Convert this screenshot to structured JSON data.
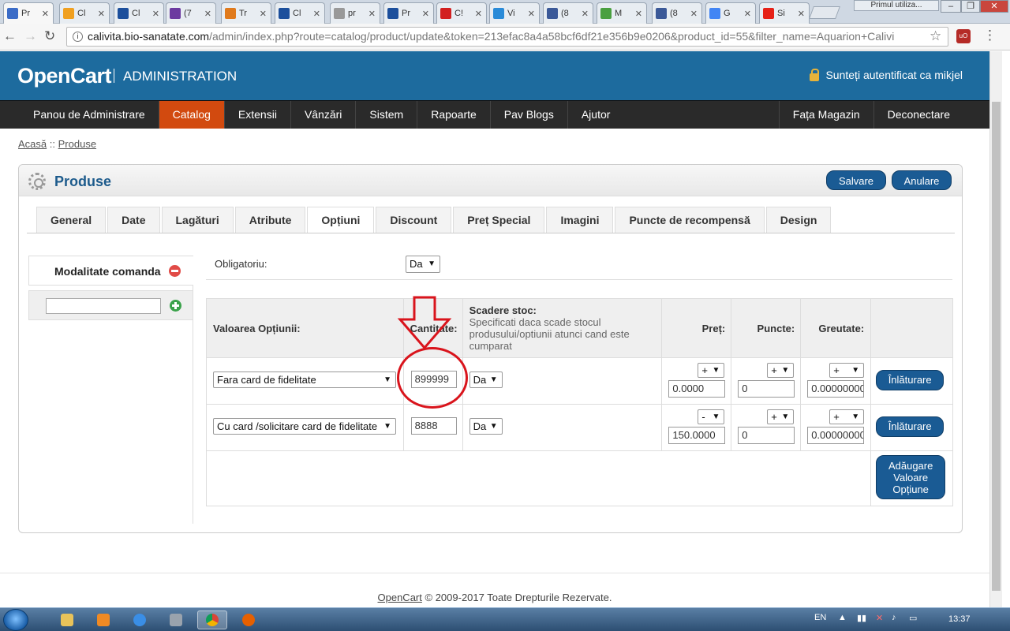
{
  "browser": {
    "tabs": [
      {
        "label": "Pr",
        "color": "#3b6cc7"
      },
      {
        "label": "Cl",
        "color": "#f0a020"
      },
      {
        "label": "Cl",
        "color": "#1c4f9c"
      },
      {
        "label": "(7",
        "color": "#6c3aa0"
      },
      {
        "label": "Tr",
        "color": "#e07a1c"
      },
      {
        "label": "Cl",
        "color": "#1c4f9c"
      },
      {
        "label": "pr",
        "color": "#999999"
      },
      {
        "label": "Pr",
        "color": "#1c4f9c"
      },
      {
        "label": "C!",
        "color": "#d22020"
      },
      {
        "label": "Vi",
        "color": "#2a8bd8"
      },
      {
        "label": "(8",
        "color": "#3b5998"
      },
      {
        "label": "M",
        "color": "#4aa040"
      },
      {
        "label": "(8",
        "color": "#3b5998"
      },
      {
        "label": "G",
        "color": "#4285f4"
      },
      {
        "label": "Si",
        "color": "#e62117"
      }
    ],
    "profile": "Primul utiliza...",
    "url_domain": "calivita.bio-sanatate.com",
    "url_path": "/admin/index.php?route=catalog/product/update&token=213efac8a4a58bcf6df21e356b9e0206&product_id=55&filter_name=Aquarion+Calivi"
  },
  "oc": {
    "logo": "OpenCart",
    "subtitle": "ADMINISTRATION",
    "login_text": "Sunteți autentificat ca mikjel",
    "menu": [
      "Panou de Administrare",
      "Catalog",
      "Extensii",
      "Vânzări",
      "Sistem",
      "Rapoarte",
      "Pav Blogs",
      "Ajutor"
    ],
    "menu_right": [
      "Fața Magazin",
      "Deconectare"
    ],
    "breadcrumb": [
      "Acasă",
      "Produse"
    ],
    "breadcrumb_sep": "::"
  },
  "page": {
    "title": "Produse",
    "save": "Salvare",
    "cancel": "Anulare",
    "tabs": [
      "General",
      "Date",
      "Lagături",
      "Atribute",
      "Opțiuni",
      "Discount",
      "Preț Special",
      "Imagini",
      "Puncte de recompensă",
      "Design"
    ],
    "option_tab": "Modalitate comanda",
    "new_option_value": "",
    "required_label": "Obligatoriu:",
    "required_value": "Da"
  },
  "table": {
    "headers": {
      "value": "Valoarea Opțiunii:",
      "quantity": "Cantitate:",
      "subtract": "Scadere stoc:",
      "subtract_hint": "Specificati daca scade stocul produsului/optiunii atunci cand este cumparat",
      "price": "Preț:",
      "points": "Puncte:",
      "weight": "Greutate:"
    },
    "rows": [
      {
        "value": "Fara card de fidelitate",
        "quantity": "899999",
        "subtract": "Da",
        "price_prefix": "+",
        "price": "0.0000",
        "points_prefix": "+",
        "points": "0",
        "weight_prefix": "+",
        "weight": "0.00000000",
        "remove": "Înlăturare"
      },
      {
        "value": "Cu card /solicitare card de fidelitate",
        "quantity": "8888",
        "subtract": "Da",
        "price_prefix": "-",
        "price": "150.0000",
        "points_prefix": "+",
        "points": "0",
        "weight_prefix": "+",
        "weight": "0.00000000",
        "remove": "Înlăturare"
      }
    ],
    "add_value": "Adăugare Valoare Opțiune"
  },
  "footer": {
    "link": "OpenCart",
    "text": "© 2009-2017 Toate Drepturile Rezervate."
  },
  "taskbar": {
    "lang": "EN",
    "time": "13:37"
  },
  "colors": {
    "header": "#1d6b9e",
    "menu_active": "#d24a0f",
    "button": "#1a5b94",
    "annotation": "#d9141c"
  }
}
